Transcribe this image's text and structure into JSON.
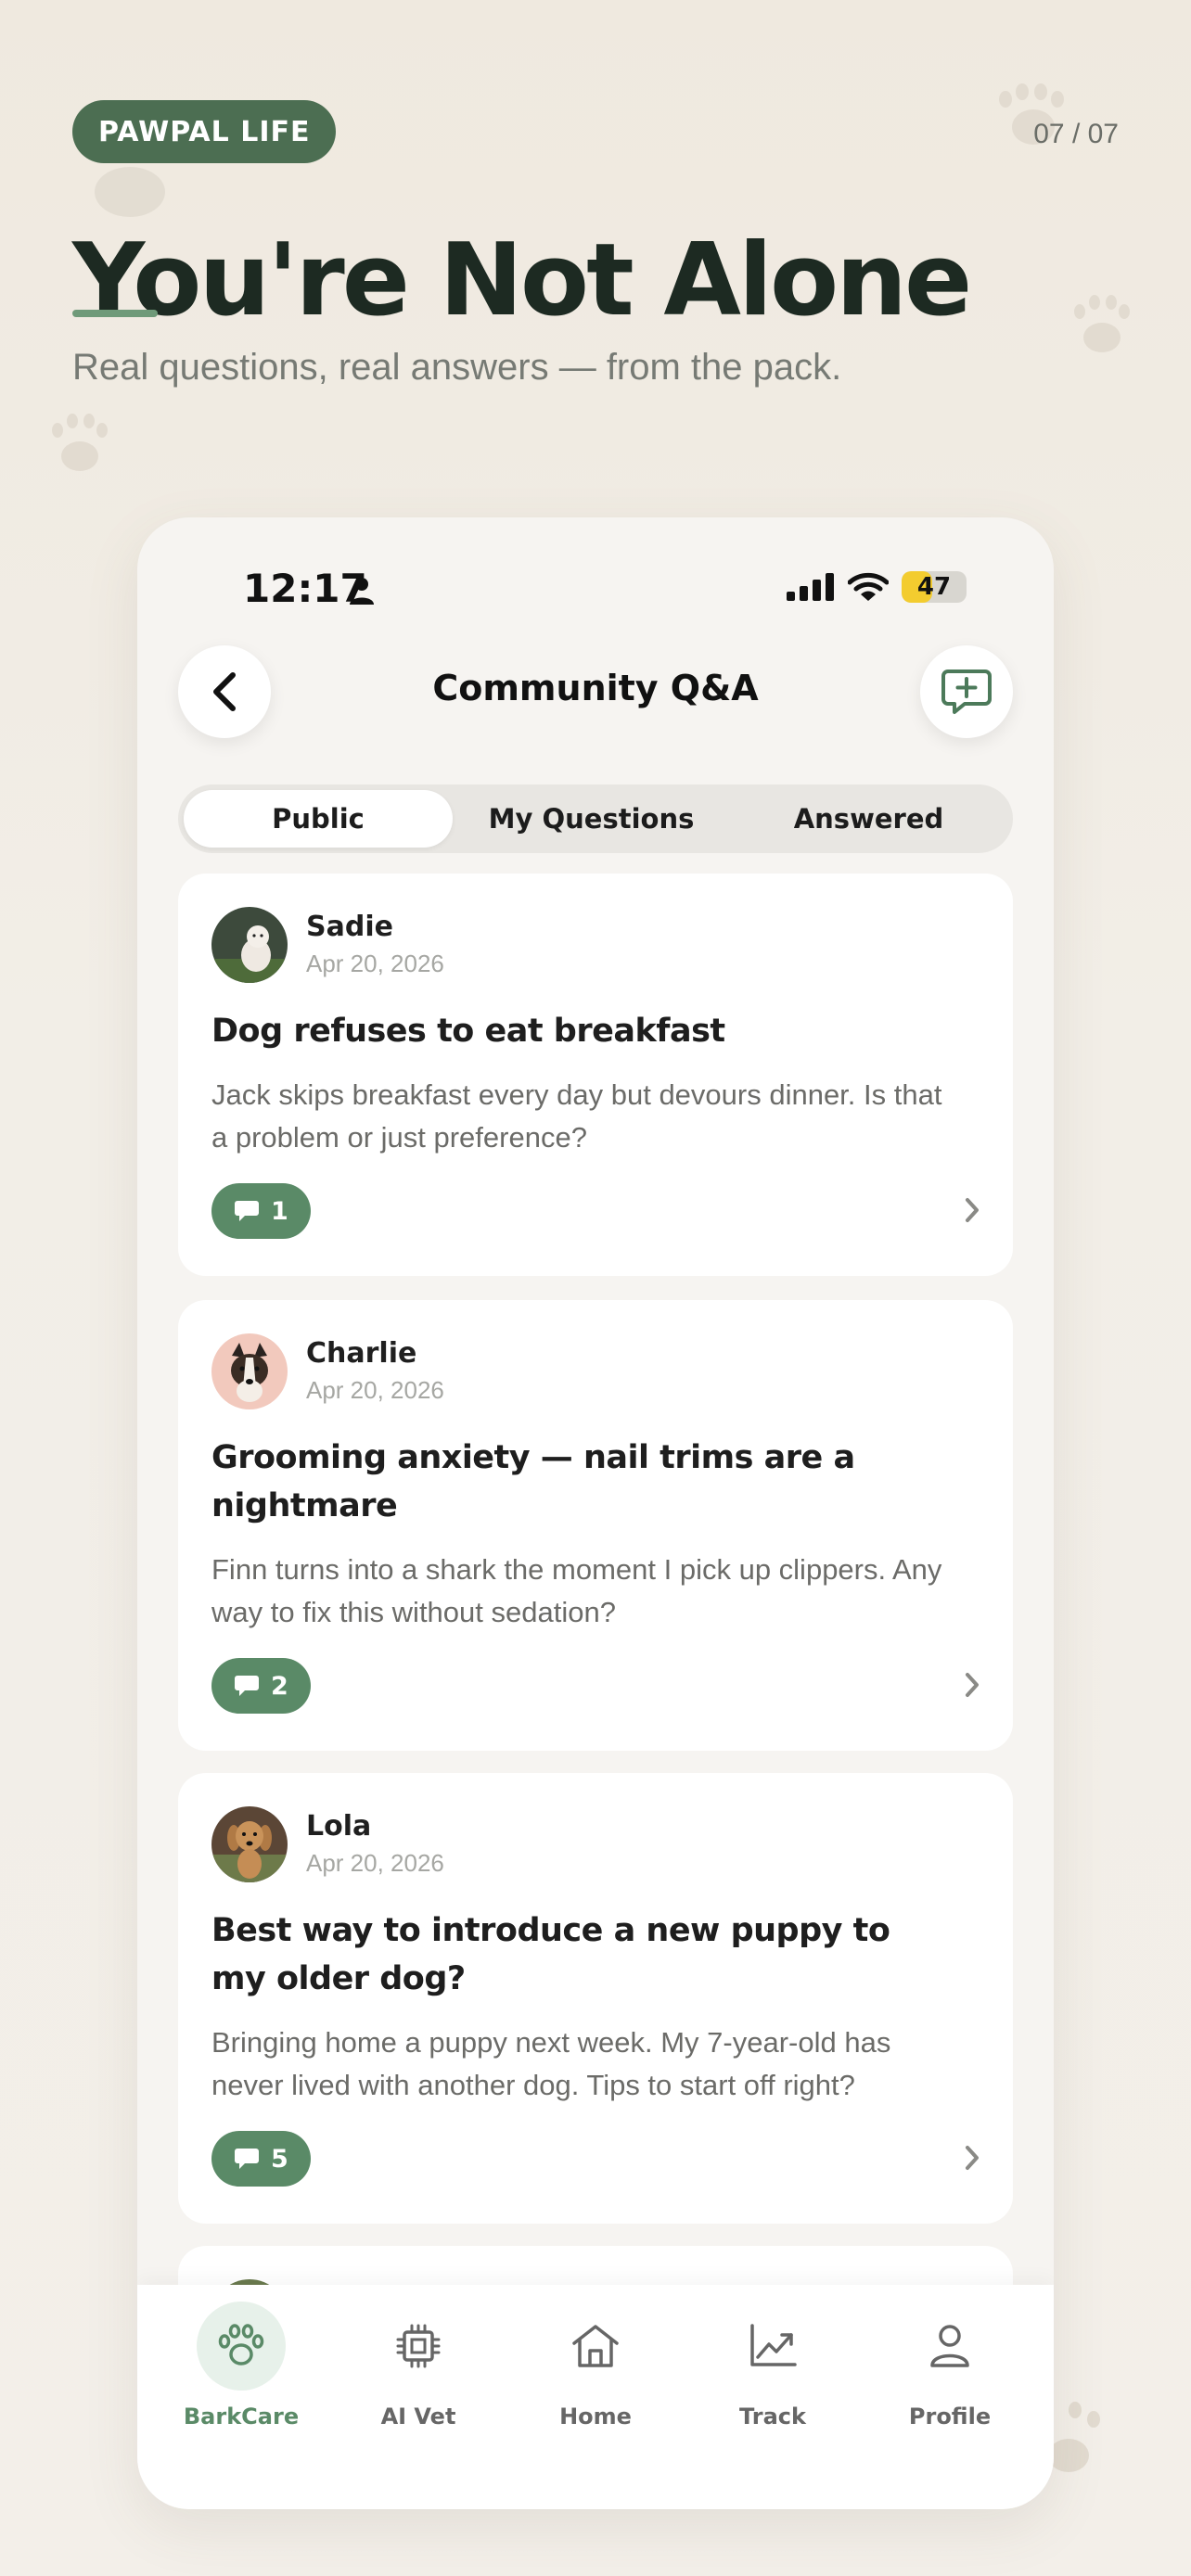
{
  "badge": "PAWPAL LIFE",
  "pager": "07 / 07",
  "headline": "You're Not Alone",
  "subhead": "Real questions, real answers — from the pack.",
  "status": {
    "time": "12:17",
    "battery": "47",
    "battery_level": 0.47
  },
  "nav": {
    "title": "Community Q&A"
  },
  "tabs": [
    "Public",
    "My Questions",
    "Answered"
  ],
  "active_tab": "Public",
  "posts": [
    {
      "author": "Sadie",
      "date": "Apr 20, 2026",
      "title": "Dog refuses to eat breakfast",
      "body": "Jack skips breakfast every day but devours dinner. Is that a problem or just preference?",
      "replies": "1"
    },
    {
      "author": "Charlie",
      "date": "Apr 20, 2026",
      "title": "Grooming anxiety — nail trims are a nightmare",
      "body": "Finn turns into a shark the moment I pick up clippers. Any way to fix this without sedation?",
      "replies": "2"
    },
    {
      "author": "Lola",
      "date": "Apr 20, 2026",
      "title": "Best way to introduce a new puppy to my older dog?",
      "body": "Bringing home a puppy next week. My 7-year-old has never lived with another dog. Tips to start off right?",
      "replies": "5"
    }
  ],
  "tabbar": [
    {
      "label": "BarkCare",
      "icon": "paw-icon",
      "active": true
    },
    {
      "label": "AI Vet",
      "icon": "chip-icon",
      "active": false
    },
    {
      "label": "Home",
      "icon": "home-icon",
      "active": false
    },
    {
      "label": "Track",
      "icon": "chart-icon",
      "active": false
    },
    {
      "label": "Profile",
      "icon": "person-icon",
      "active": false
    }
  ],
  "colors": {
    "accent": "#5a8a67",
    "badge": "#4c6e52",
    "background": "#f1ece4"
  }
}
